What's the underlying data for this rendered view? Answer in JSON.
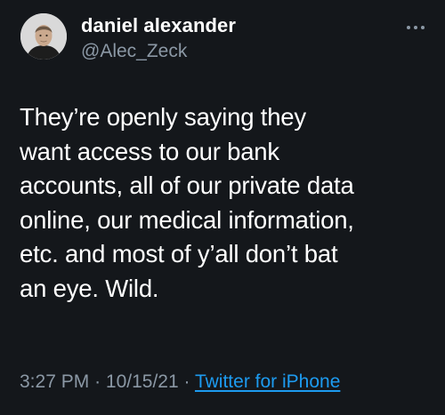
{
  "tweet": {
    "author": {
      "display_name": "daniel alexander",
      "handle": "@Alec_Zeck",
      "avatar_icon": "profile-photo"
    },
    "more_icon": "more-dots-icon",
    "text": "They’re openly saying they\nwant access to our bank\naccounts, all of our private data\nonline, our medical information,\netc. and most of y’all don’t bat\nan eye. Wild.",
    "meta": {
      "time": "3:27 PM",
      "separator": "·",
      "date": "10/15/21",
      "source": "Twitter for iPhone"
    }
  },
  "colors": {
    "background": "#14171b",
    "text": "#ffffff",
    "secondary": "#8b98a5",
    "link": "#1d9bf0"
  }
}
